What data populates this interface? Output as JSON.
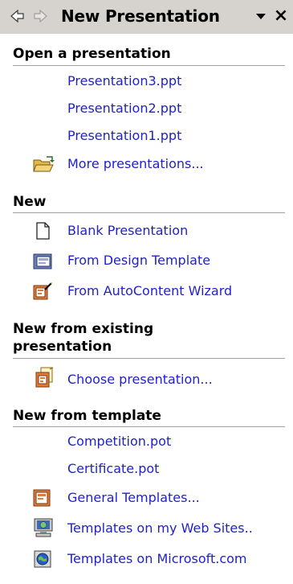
{
  "pane": {
    "title": "New Presentation",
    "back_icon": "back-arrow-icon",
    "forward_icon": "forward-arrow-icon",
    "menu_icon": "dropdown-triangle-icon",
    "close_label": "×"
  },
  "sections": {
    "open": {
      "header": "Open a presentation",
      "items": [
        "Presentation3.ppt",
        "Presentation2.ppt",
        "Presentation1.ppt"
      ],
      "more_label": "More presentations..."
    },
    "new": {
      "header": "New",
      "blank": "Blank Presentation",
      "design": "From Design Template",
      "autocontent": "From AutoContent Wizard"
    },
    "existing": {
      "header_line1": "New from existing",
      "header_line2": "presentation",
      "choose": "Choose presentation..."
    },
    "template": {
      "header": "New from template",
      "items": [
        "Competition.pot",
        "Certificate.pot"
      ],
      "general": "General Templates...",
      "web_sites": "Templates on my Web Sites..",
      "microsoft": "Templates on Microsoft.com"
    }
  },
  "colors": {
    "link": "#1f1fcc",
    "titlebar": "#d6d3ce",
    "rule": "#a0a0a0"
  }
}
